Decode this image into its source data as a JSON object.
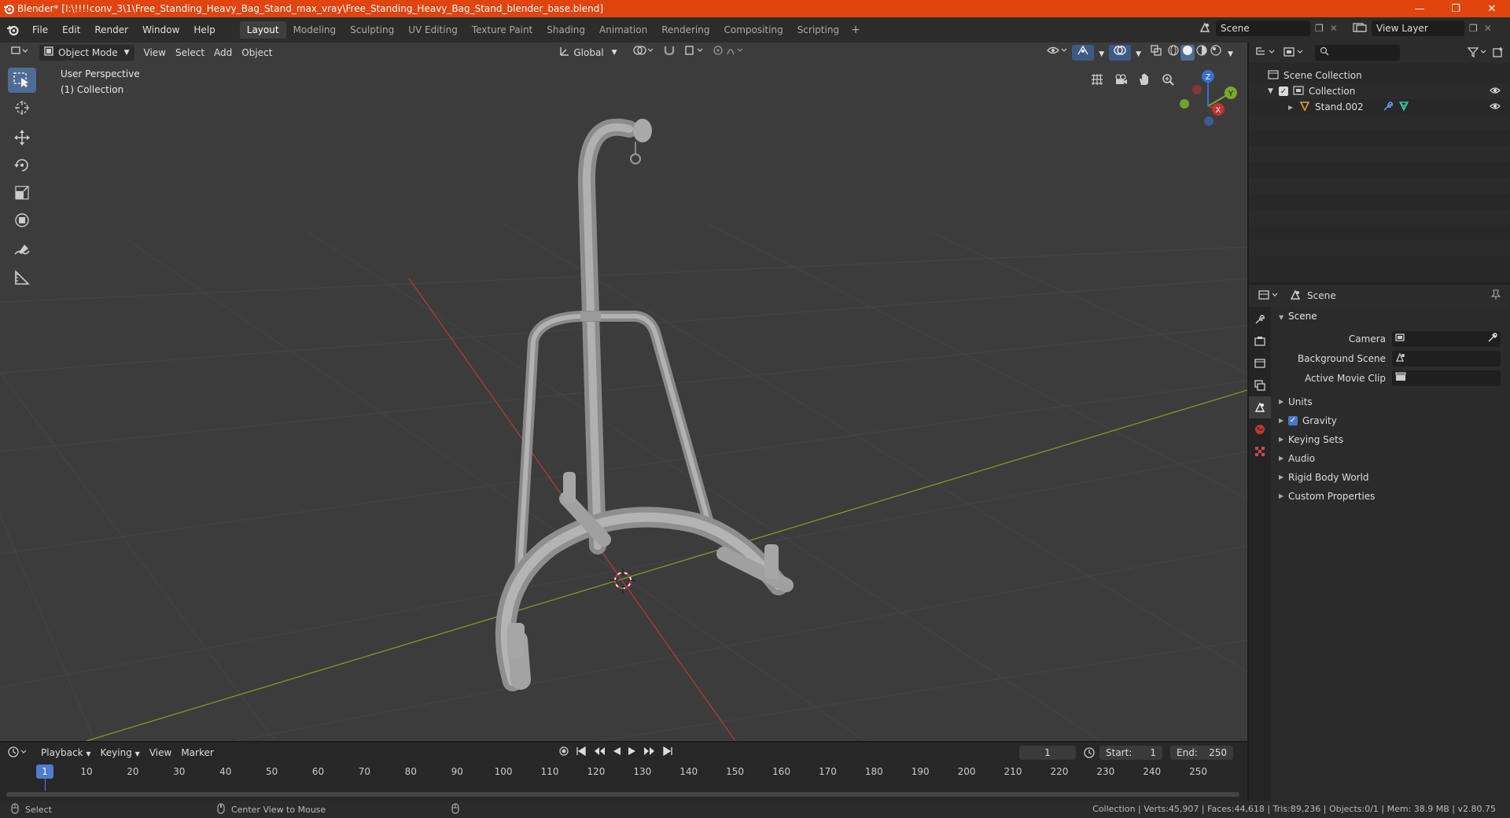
{
  "window": {
    "title": "Blender* [I:\\!!!!conv_3\\1\\Free_Standing_Heavy_Bag_Stand_max_vray\\Free_Standing_Heavy_Bag_Stand_blender_base.blend]",
    "accent_color": "#e2440f"
  },
  "menu": {
    "items": [
      "File",
      "Edit",
      "Render",
      "Window",
      "Help"
    ]
  },
  "workspaces": {
    "tabs": [
      "Layout",
      "Modeling",
      "Sculpting",
      "UV Editing",
      "Texture Paint",
      "Shading",
      "Animation",
      "Rendering",
      "Compositing",
      "Scripting"
    ],
    "active": "Layout"
  },
  "scene_selector": {
    "value": "Scene"
  },
  "view_layer": {
    "value": "View Layer"
  },
  "viewport": {
    "mode": "Object Mode",
    "menus": [
      "View",
      "Select",
      "Add",
      "Object"
    ],
    "orientation": "Global",
    "info_line1": "User Perspective",
    "info_line2": "(1) Collection",
    "gizmo": {
      "x": "X",
      "y": "Y",
      "z": "Z"
    }
  },
  "outliner": {
    "rows": [
      {
        "label": "Scene Collection"
      },
      {
        "label": "Collection"
      },
      {
        "label": "Stand.002"
      }
    ]
  },
  "properties": {
    "header": "Scene",
    "panel": "Scene",
    "fields": [
      {
        "label": "Camera"
      },
      {
        "label": "Background Scene"
      },
      {
        "label": "Active Movie Clip"
      }
    ],
    "subpanels": [
      "Units",
      "Gravity",
      "Keying Sets",
      "Audio",
      "Rigid Body World",
      "Custom Properties"
    ],
    "gravity_checked": true
  },
  "timeline": {
    "menus": [
      "Playback",
      "Keying",
      "View",
      "Marker"
    ],
    "current_frame": "1",
    "start_label": "Start:",
    "start": "1",
    "end_label": "End:",
    "end": "250",
    "ruler": [
      "1",
      "10",
      "20",
      "30",
      "40",
      "50",
      "60",
      "70",
      "80",
      "90",
      "100",
      "110",
      "120",
      "130",
      "140",
      "150",
      "160",
      "170",
      "180",
      "190",
      "200",
      "210",
      "220",
      "230",
      "240",
      "250"
    ]
  },
  "statusbar": {
    "left_action": "Select",
    "middle_action": "Center View to Mouse",
    "stats": "Collection | Verts:45,907 | Faces:44,618 | Tris:89,236 | Objects:0/1 | Mem: 38.9 MB | v2.80.75"
  }
}
